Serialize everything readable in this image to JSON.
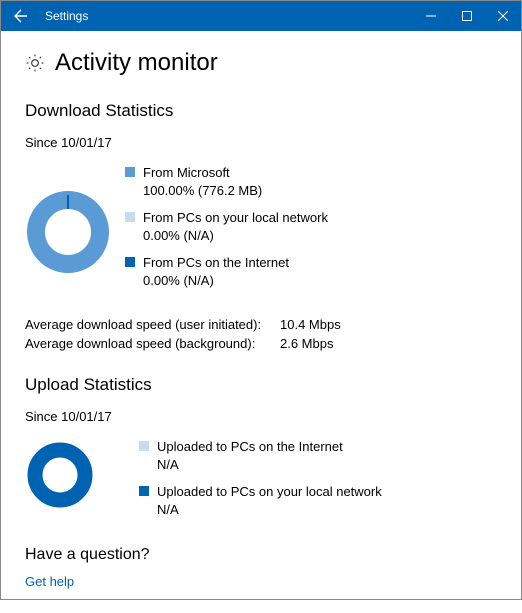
{
  "titlebar": {
    "app": "Settings"
  },
  "page": {
    "title": "Activity monitor"
  },
  "download": {
    "heading": "Download Statistics",
    "since": "Since 10/01/17",
    "legend": [
      {
        "label": "From Microsoft",
        "value": "100.00%  (776.2 MB)"
      },
      {
        "label": "From PCs on your local network",
        "value": "0.00%  (N/A)"
      },
      {
        "label": "From PCs on the Internet",
        "value": "0.00%  (N/A)"
      }
    ],
    "avg_user_label": "Average download speed (user initiated):",
    "avg_user_value": "10.4 Mbps",
    "avg_bg_label": "Average download speed (background):",
    "avg_bg_value": "2.6 Mbps"
  },
  "upload": {
    "heading": "Upload Statistics",
    "since": "Since 10/01/17",
    "legend": [
      {
        "label": "Uploaded to PCs on the Internet",
        "value": "N/A"
      },
      {
        "label": "Uploaded to PCs on your local network",
        "value": "N/A"
      }
    ]
  },
  "help": {
    "heading": "Have a question?",
    "link": "Get help"
  },
  "colors": {
    "brand": "#0063b1",
    "series_a": "#5a9bd5",
    "series_b": "#c8dcef",
    "series_c": "#0063b1"
  },
  "chart_data": [
    {
      "type": "pie",
      "title": "Download sources",
      "categories": [
        "From Microsoft",
        "From PCs on your local network",
        "From PCs on the Internet"
      ],
      "values": [
        100.0,
        0.0,
        0.0
      ],
      "sizes_mb": [
        776.2,
        null,
        null
      ]
    },
    {
      "type": "pie",
      "title": "Upload destinations",
      "categories": [
        "Uploaded to PCs on the Internet",
        "Uploaded to PCs on your local network"
      ],
      "values": [
        null,
        null
      ]
    }
  ]
}
